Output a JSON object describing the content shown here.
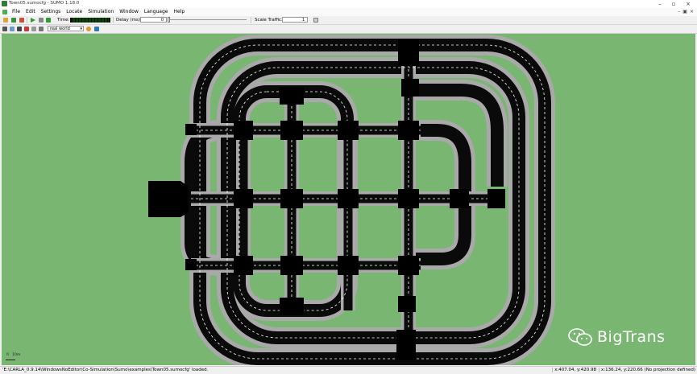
{
  "window": {
    "title": "Town05.sumocfg - SUMO 1.18.0"
  },
  "menu": [
    "File",
    "Edit",
    "Settings",
    "Locate",
    "Simulation",
    "Window",
    "Language",
    "Help"
  ],
  "toolbar": {
    "time_label": "Time:",
    "delay_label": "Delay (ms):",
    "delay_value": "0",
    "scale_label": "Scale Traffic:",
    "scale_value": "1"
  },
  "view": {
    "scheme": "real world"
  },
  "scale_bar": {
    "zero": "0",
    "length": "10m"
  },
  "watermark": {
    "text": "BigTrans"
  },
  "status": {
    "message": "'E:\\CARLA_0.9.14\\WindowsNoEditor\\Co-Simulation\\Sumo\\examples\\Town05.sumocfg' loaded.",
    "cursor_coords": "x:407.04, y:420.98",
    "geo_coords": "x:136.24, y:220.66 (No projection defined)"
  },
  "colors": {
    "canvas": "#79b672",
    "road": "#0a0a0a",
    "sidewalk": "#a9a9a9",
    "lane_mark": "#ffffff"
  }
}
